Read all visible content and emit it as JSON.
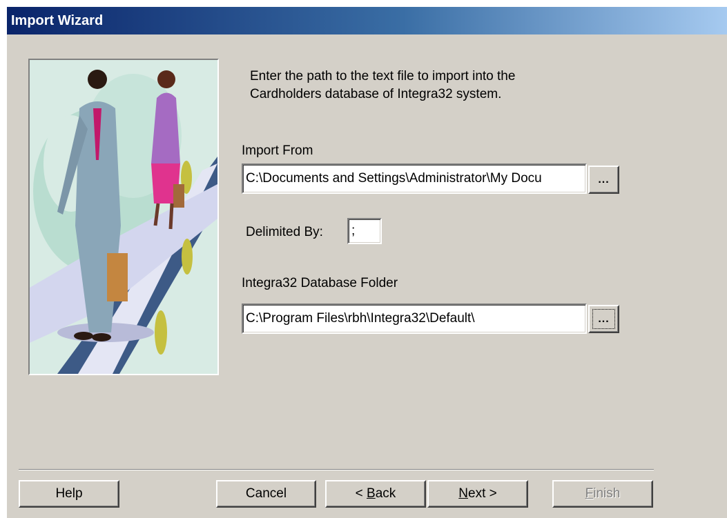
{
  "window": {
    "title": "Import Wizard"
  },
  "instructions": {
    "line1": "Enter the path to the text file to import into the",
    "line2": "Cardholders database of Integra32 system."
  },
  "import_from": {
    "label": "Import From",
    "value": "C:\\Documents and Settings\\Administrator\\My Docu",
    "browse_label": "..."
  },
  "delimiter": {
    "label": "Delimited By:",
    "value": ";"
  },
  "database_folder": {
    "label": "Integra32 Database Folder",
    "value": "C:\\Program Files\\rbh\\Integra32\\Default\\",
    "browse_label": "..."
  },
  "buttons": {
    "help": "Help",
    "cancel": "Cancel",
    "back_prefix": "< ",
    "back_mnemonic": "B",
    "back_rest": "ack",
    "next_mnemonic": "N",
    "next_rest": "ext >",
    "finish_mnemonic": "F",
    "finish_rest": "inish"
  },
  "colors": {
    "dialog_bg": "#d4d0c8",
    "title_start": "#0a246a",
    "title_end": "#a6caf0",
    "disabled_text": "#808080"
  },
  "icons": {
    "wizard_picture": "business-people-walkway-clipart"
  }
}
